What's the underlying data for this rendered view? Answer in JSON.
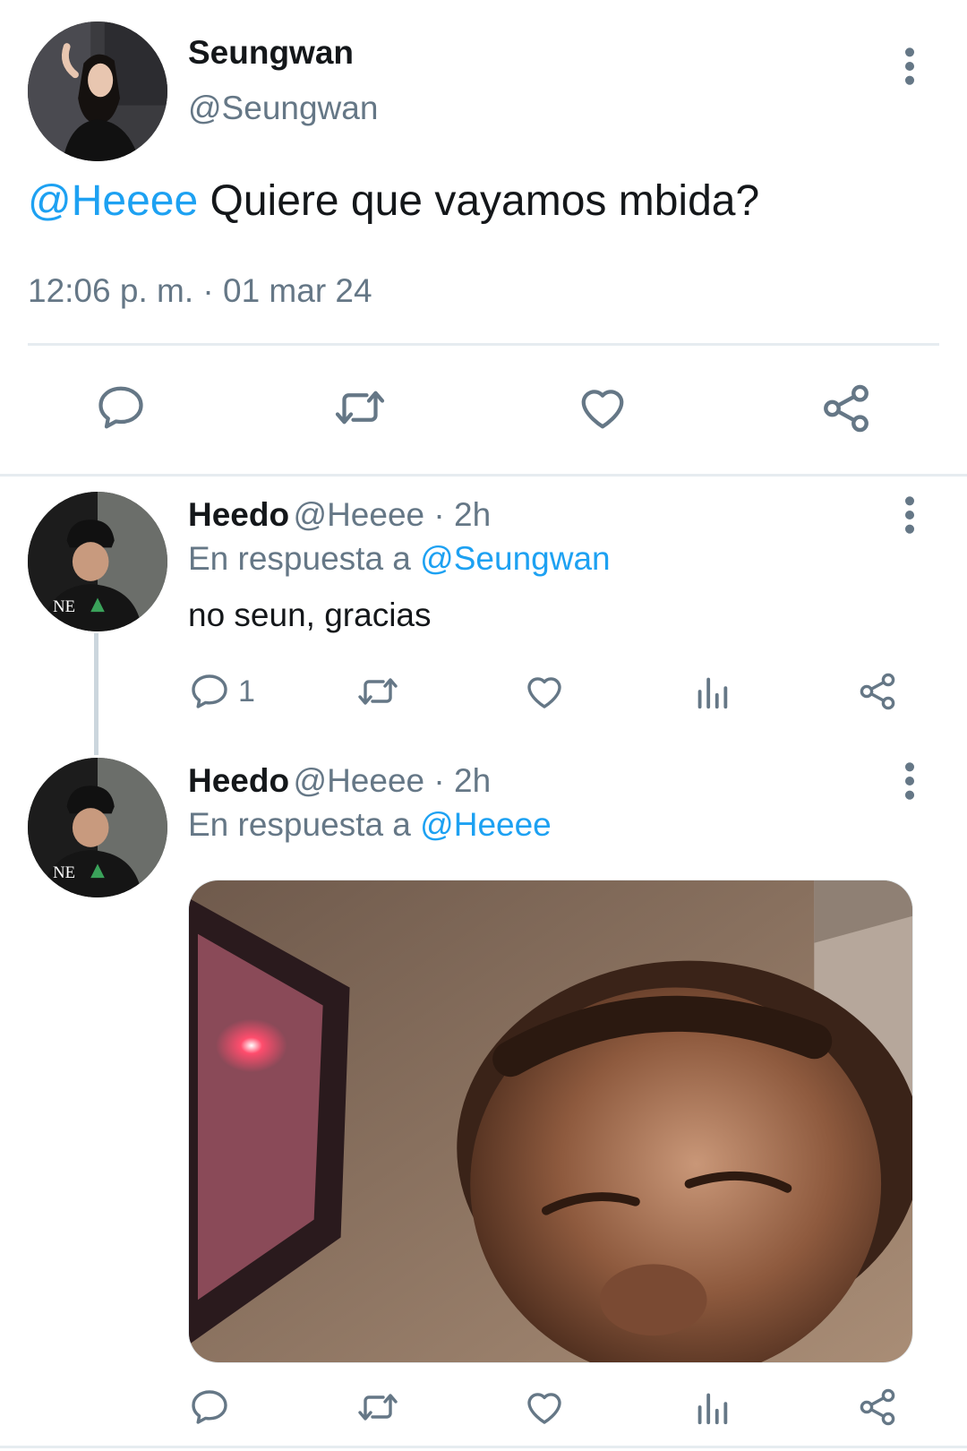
{
  "main_tweet": {
    "author_name": "Seungwan",
    "author_handle": "@Seungwan",
    "mention": "@Heeee",
    "text": " Quiere que vayamos mbida?",
    "timestamp": "12:06 p. m. · 01 mar 24",
    "actions": [
      "reply-icon",
      "retweet-icon",
      "like-icon",
      "share-icon"
    ]
  },
  "replies": [
    {
      "author_name": "Heedo",
      "author_handle": "@Heeee",
      "time": " · 2h",
      "reply_prefix": "En respuesta a ",
      "reply_to": "@Seungwan",
      "text": "no seun, gracias",
      "reply_count": "1",
      "actions": [
        "reply-icon",
        "retweet-icon",
        "like-icon",
        "analytics-icon",
        "share-icon"
      ]
    },
    {
      "author_name": "Heedo",
      "author_handle": "@Heeee",
      "time": " · 2h",
      "reply_prefix": "En respuesta a ",
      "reply_to": "@Heeee",
      "has_media": true,
      "actions": [
        "reply-icon",
        "retweet-icon",
        "like-icon",
        "analytics-icon",
        "share-icon"
      ]
    }
  ],
  "colors": {
    "accent": "#1da1f2",
    "secondary_text": "#657786",
    "divider": "#e6ecf0"
  }
}
